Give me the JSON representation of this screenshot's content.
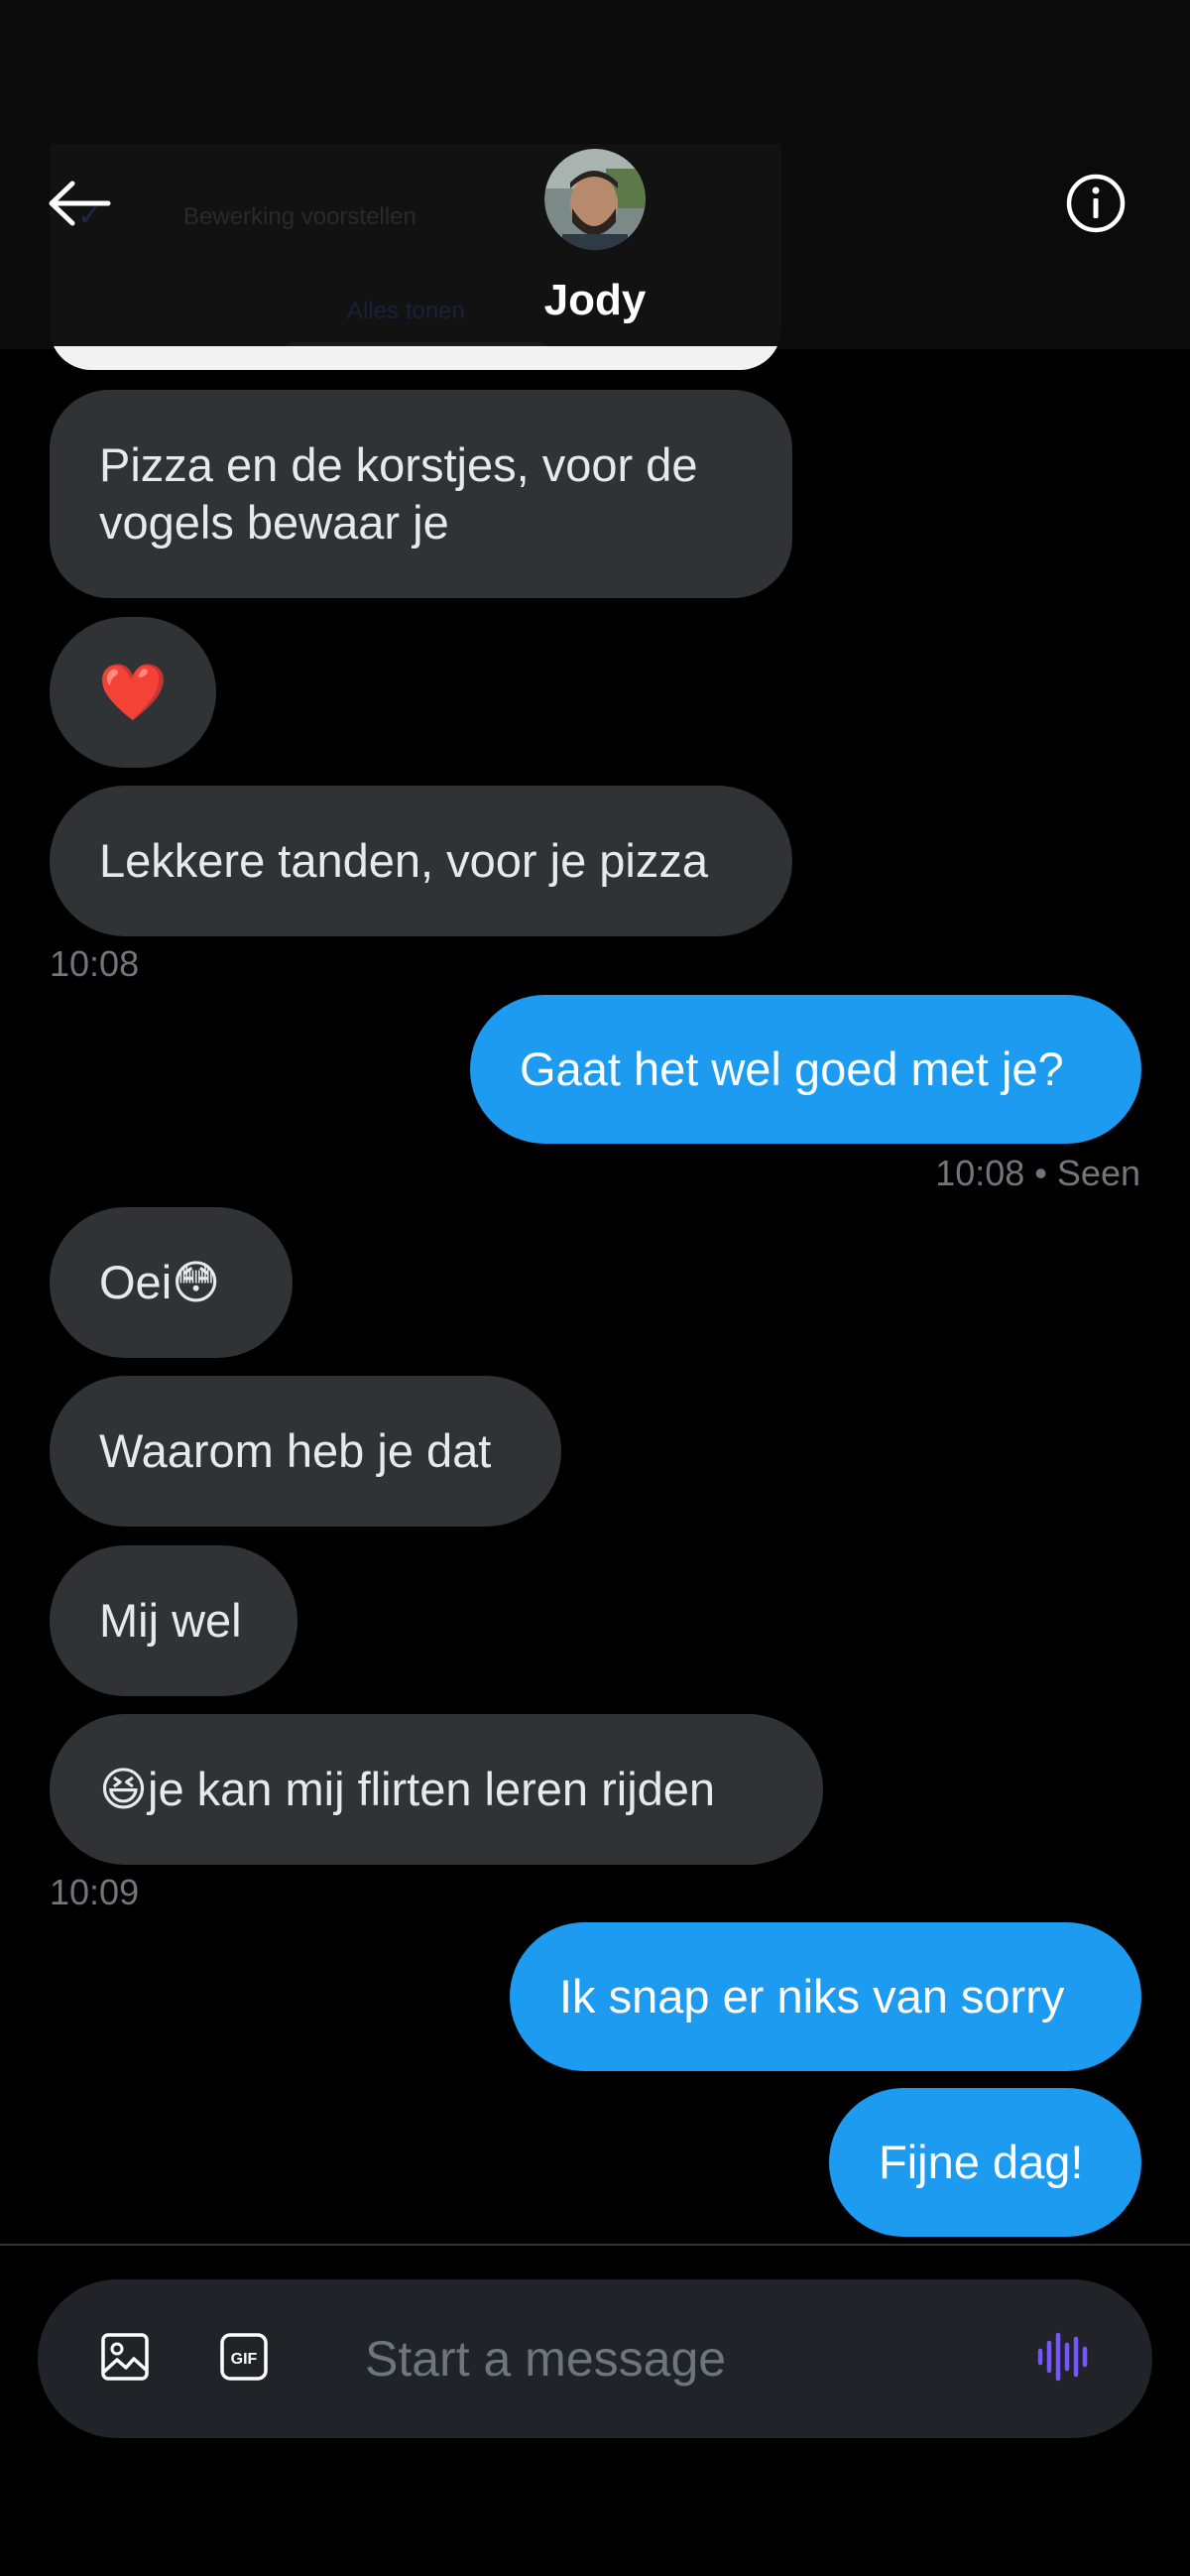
{
  "header": {
    "contact_name": "Jody",
    "ghost_edit_text": "Bewerking voorstellen",
    "ghost_all_text": "Alles tonen"
  },
  "messages": [
    {
      "dir": "in",
      "text": "Pizza en de korstjes, voor de vogels bewaar je"
    },
    {
      "dir": "in",
      "text": "❤️"
    },
    {
      "dir": "in",
      "text": "Lekkere tanden, voor je pizza"
    },
    {
      "timestamp": "10:08"
    },
    {
      "dir": "out",
      "text": "Gaat het wel goed met je?"
    },
    {
      "timestamp": "10:08 • Seen"
    },
    {
      "dir": "in",
      "text": "Oei😳"
    },
    {
      "dir": "in",
      "text": "Waarom heb je dat"
    },
    {
      "dir": "in",
      "text": "Mij wel"
    },
    {
      "dir": "in",
      "text": "😆je kan mij flirten leren rijden"
    },
    {
      "timestamp": "10:09"
    },
    {
      "dir": "out",
      "text": "Ik snap er niks van sorry"
    },
    {
      "dir": "out",
      "text": "Fijne dag!"
    }
  ],
  "composer": {
    "placeholder": "Start a message",
    "icons": [
      "image-icon",
      "gif-icon",
      "voice-icon"
    ],
    "gif_label": "GIF"
  },
  "colors": {
    "incoming_bubble": "#2f3336",
    "outgoing_bubble": "#1d9bf0",
    "voice_accent": "#7856ff",
    "timestamp": "#71767b"
  }
}
